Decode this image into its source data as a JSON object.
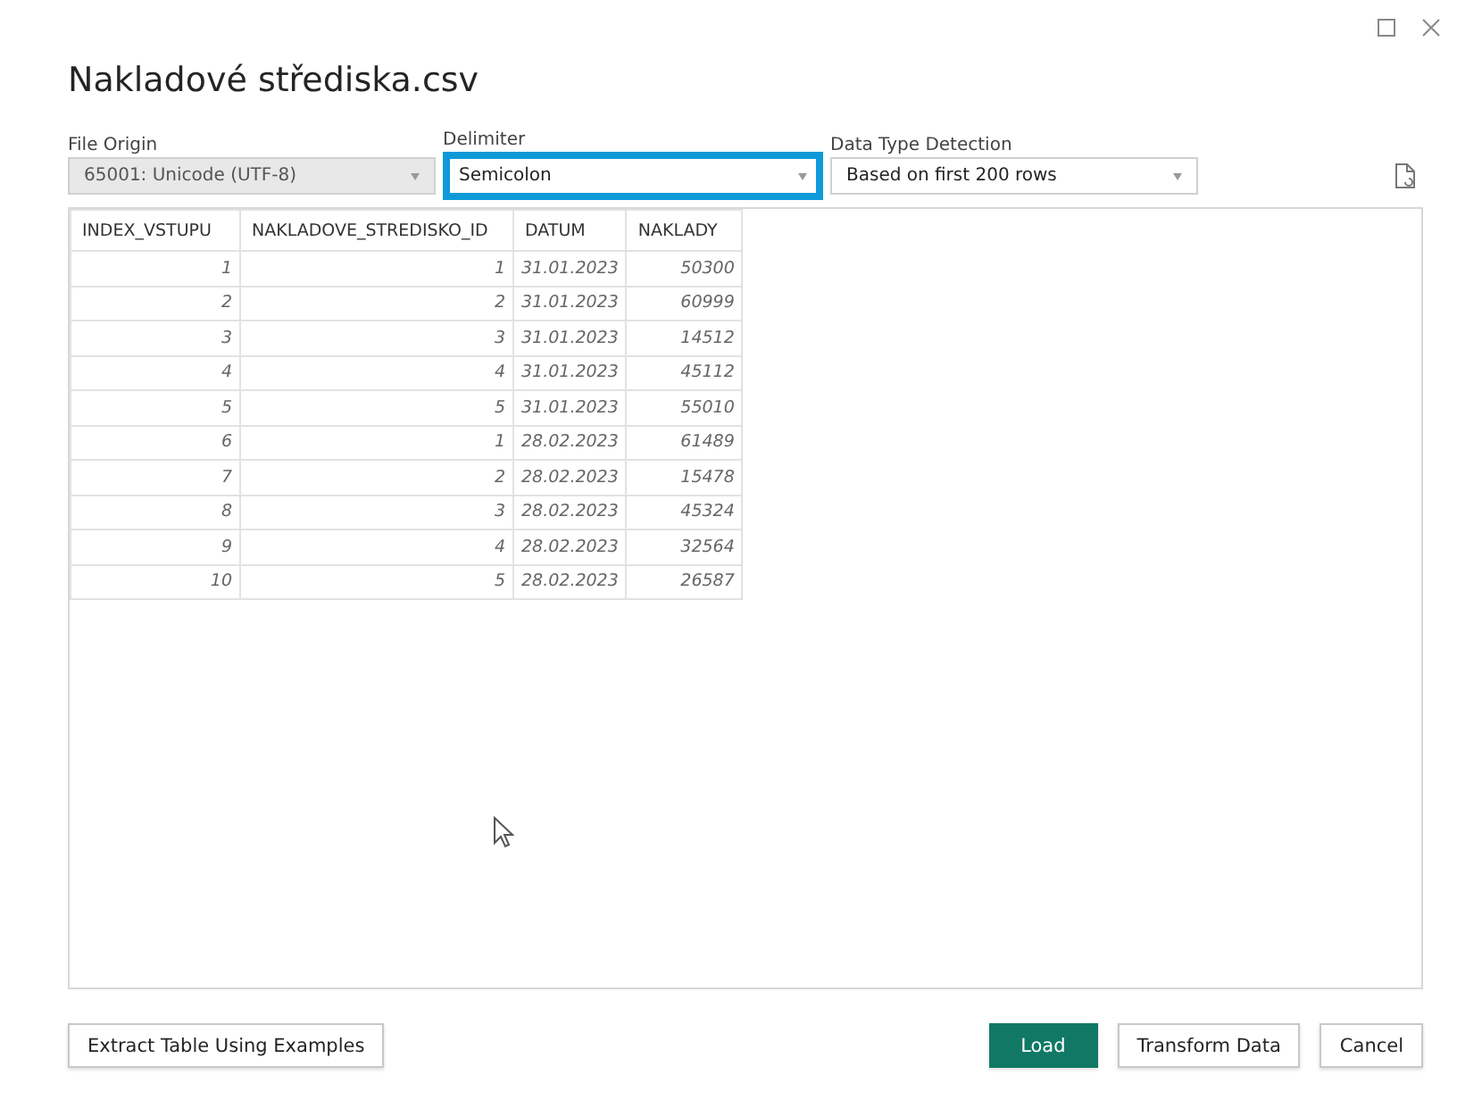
{
  "window": {
    "title": "Nakladové střediska.csv"
  },
  "options": [
    {
      "label": "File Origin",
      "value": "65001: Unicode (UTF-8)",
      "disabled": true,
      "focused": false
    },
    {
      "label": "Delimiter",
      "value": "Semicolon",
      "disabled": false,
      "focused": true
    },
    {
      "label": "Data Type Detection",
      "value": "Based on first 200 rows",
      "disabled": false,
      "focused": false
    }
  ],
  "table": {
    "columns": [
      "INDEX_VSTUPU",
      "NAKLADOVE_STREDISKO_ID",
      "DATUM",
      "NAKLADY"
    ],
    "rows": [
      [
        "1",
        "1",
        "31.01.2023",
        "50300"
      ],
      [
        "2",
        "2",
        "31.01.2023",
        "60999"
      ],
      [
        "3",
        "3",
        "31.01.2023",
        "14512"
      ],
      [
        "4",
        "4",
        "31.01.2023",
        "45112"
      ],
      [
        "5",
        "5",
        "31.01.2023",
        "55010"
      ],
      [
        "6",
        "1",
        "28.02.2023",
        "61489"
      ],
      [
        "7",
        "2",
        "28.02.2023",
        "15478"
      ],
      [
        "8",
        "3",
        "28.02.2023",
        "45324"
      ],
      [
        "9",
        "4",
        "28.02.2023",
        "32564"
      ],
      [
        "10",
        "5",
        "28.02.2023",
        "26587"
      ]
    ]
  },
  "buttons": [
    {
      "label": "Extract Table Using Examples",
      "kind": "secondary"
    },
    {
      "label": "Load",
      "kind": "primary"
    },
    {
      "label": "Transform Data",
      "kind": "secondary"
    },
    {
      "label": "Cancel",
      "kind": "secondary"
    }
  ]
}
